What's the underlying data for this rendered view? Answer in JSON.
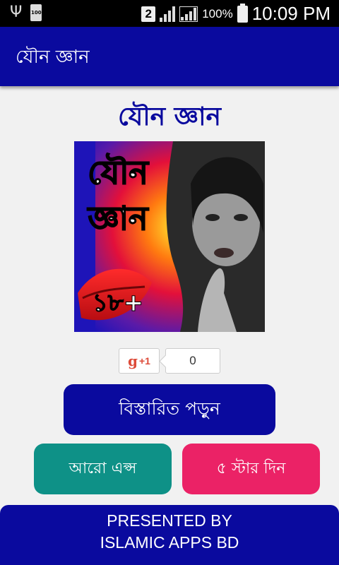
{
  "status_bar": {
    "sim": "2",
    "battery_small": "100",
    "battery_percent": "100%",
    "time": "10:09 PM",
    "icons": [
      "usb-icon",
      "battery-small-icon",
      "sim-icon",
      "signal-icon",
      "battery-icon"
    ]
  },
  "app_bar": {
    "title": "যৌন জ্ঞান"
  },
  "main": {
    "title": "যৌন জ্ঞান",
    "banner": {
      "line1": "যৌন",
      "line2": "জ্ঞান",
      "age": "১৮+"
    },
    "gplus": {
      "label": "g",
      "plus": "+1",
      "count": "0"
    },
    "details_button": "বিস্তারিত পড়ুন",
    "more_apps_button": "আরো এপ্স",
    "rate_button": "৫ স্টার দিন"
  },
  "footer": {
    "line1": "PRESENTED BY",
    "line2": "ISLAMIC APPS BD"
  },
  "colors": {
    "primary": "#0a0a9e",
    "teal": "#0e9187",
    "pink": "#eb2266",
    "background": "#f1f1f1"
  }
}
